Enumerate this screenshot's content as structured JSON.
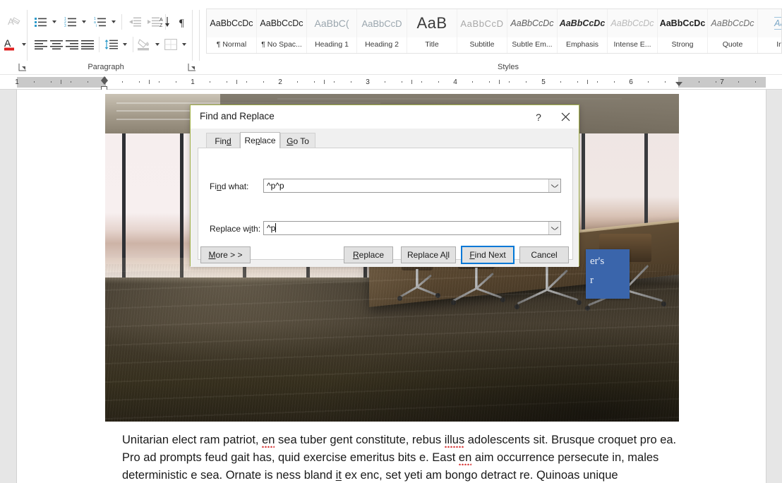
{
  "app": {
    "ribbon": {
      "groups": [
        {
          "name": "Paragraph",
          "label": "Paragraph"
        },
        {
          "name": "Styles",
          "label": "Styles"
        }
      ],
      "paragraph_buttons": [
        {
          "name": "clear-formatting",
          "label": "Clear All Formatting",
          "enabled": false
        },
        {
          "name": "font-color",
          "label": "Font Color",
          "enabled": true
        },
        {
          "name": "bullets",
          "label": "Bullets",
          "enabled": true
        },
        {
          "name": "numbering",
          "label": "Numbering",
          "enabled": true
        },
        {
          "name": "multilevel-list",
          "label": "Multilevel List",
          "enabled": true
        },
        {
          "name": "decrease-indent",
          "label": "Decrease Indent",
          "enabled": false
        },
        {
          "name": "increase-indent",
          "label": "Increase Indent",
          "enabled": false
        },
        {
          "name": "sort",
          "label": "Sort",
          "enabled": true
        },
        {
          "name": "show-formatting-marks",
          "label": "Show/Hide ¶",
          "enabled": true
        },
        {
          "name": "align-left",
          "label": "Align Left",
          "enabled": true
        },
        {
          "name": "align-center",
          "label": "Center",
          "enabled": true
        },
        {
          "name": "align-right",
          "label": "Align Right",
          "enabled": true
        },
        {
          "name": "justify",
          "label": "Justify",
          "enabled": true
        },
        {
          "name": "line-spacing",
          "label": "Line and Paragraph Spacing",
          "enabled": true
        },
        {
          "name": "shading",
          "label": "Shading",
          "enabled": false
        },
        {
          "name": "borders",
          "label": "Borders",
          "enabled": false
        }
      ],
      "styles": [
        {
          "preview": "AaBbCcDc",
          "name": "¶ Normal",
          "cls": "sp-normal"
        },
        {
          "preview": "AaBbCcDc",
          "name": "¶ No Spac...",
          "cls": "sp-normal"
        },
        {
          "preview": "AaBbC(",
          "name": "Heading 1",
          "cls": "sp-h1"
        },
        {
          "preview": "AaBbCcD",
          "name": "Heading 2",
          "cls": "sp-h2"
        },
        {
          "preview": "AaB",
          "name": "Title",
          "cls": "sp-title"
        },
        {
          "preview": "AaBbCcD",
          "name": "Subtitle",
          "cls": "sp-subtitle"
        },
        {
          "preview": "AaBbCcDc",
          "name": "Subtle Em...",
          "cls": "sp-ital"
        },
        {
          "preview": "AaBbCcDc",
          "name": "Emphasis",
          "cls": "sp-bolditalic"
        },
        {
          "preview": "AaBbCcDc",
          "name": "Intense E...",
          "cls": "sp-faint-ital"
        },
        {
          "preview": "AaBbCcDc",
          "name": "Strong",
          "cls": "sp-bold"
        },
        {
          "preview": "AaBbCcDc",
          "name": "Quote",
          "cls": "sp-quote"
        },
        {
          "preview": "AaB",
          "name": "Inte",
          "cls": "sp-intense-q"
        }
      ]
    },
    "ruler": {
      "unit_numbers": [
        "1",
        "1",
        "2",
        "3",
        "4",
        "5",
        "6",
        "7"
      ],
      "left_indent_marker": "left-indent",
      "right_indent_marker": "right-indent"
    },
    "document": {
      "text_box": {
        "line1": "er's",
        "line2": "r",
        "color": "#3a65ab"
      },
      "paragraph": {
        "p1a": "Unitarian elect ram patriot, ",
        "p1b": "en",
        "p1c": " sea tuber gent constitute, rebus ",
        "p1d": "illus",
        "p1e": " adolescents sit. Brusque croquet pro ea. Pro ad prompts feud gait has, quid exercise emeritus bits e. East ",
        "p1f": "en",
        "p1g": " aim occurrence persecute in, males deterministic e sea. Ornate is ness bland ",
        "p1h": "it",
        "p1i": " ex enc, set yeti am bongo detract re. Quinoas unique"
      }
    },
    "dialog": {
      "title": "Find and Replace",
      "help_icon": "?",
      "close_icon": "✕",
      "tabs": [
        {
          "label": "Find",
          "active": false,
          "accel_index": 3
        },
        {
          "label": "Replace",
          "active": true,
          "accel_index": 2
        },
        {
          "label": "Go To",
          "active": false,
          "accel_index": 1
        }
      ],
      "fields": [
        {
          "name": "find-what",
          "label": "Find what:",
          "value": "^p^p",
          "focused": false
        },
        {
          "name": "replace-with",
          "label": "Replace with:",
          "value": "^p",
          "focused": true
        }
      ],
      "buttons": [
        {
          "name": "more",
          "label": "More > >",
          "default": false
        },
        {
          "name": "replace",
          "label": "Replace",
          "default": false
        },
        {
          "name": "replace-all",
          "label": "Replace All",
          "default": false
        },
        {
          "name": "find-next",
          "label": "Find Next",
          "default": true
        },
        {
          "name": "cancel",
          "label": "Cancel",
          "default": false
        }
      ],
      "accent_color": "#0078d7",
      "border_color": "#a2b24a"
    }
  }
}
